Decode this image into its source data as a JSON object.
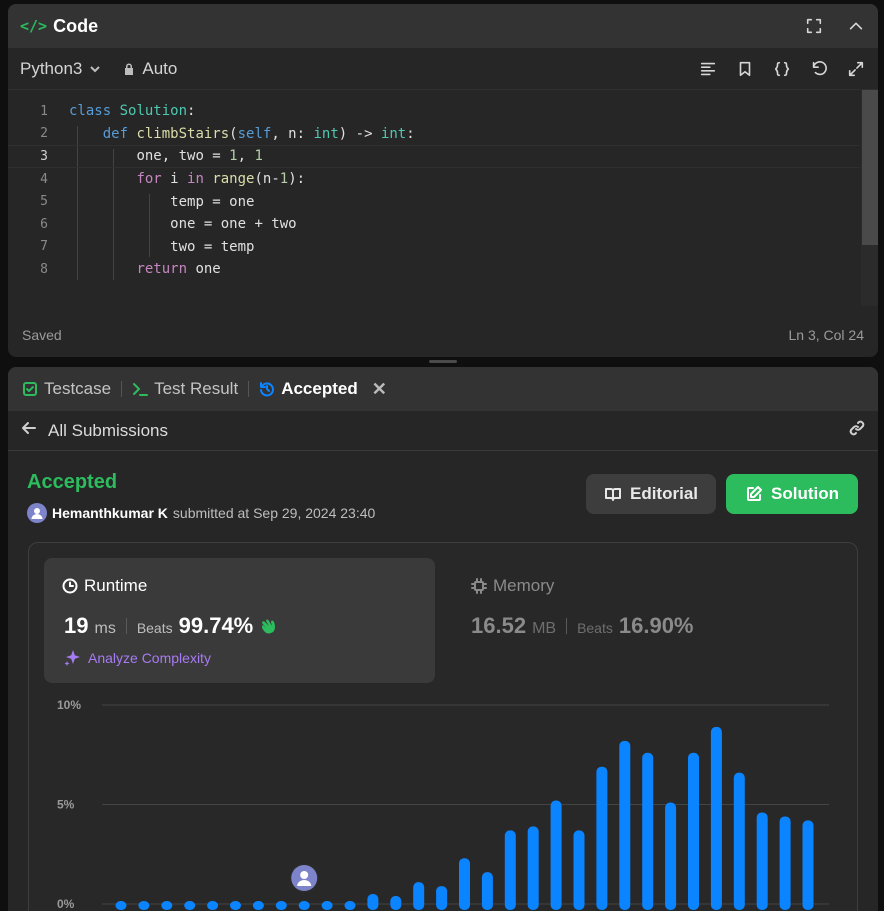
{
  "code_panel": {
    "title": "Code",
    "language": "Python3",
    "mode": "Auto",
    "status": "Saved",
    "cursor_position": "Ln 3, Col 24",
    "current_line": 3,
    "lines": [
      {
        "n": "1"
      },
      {
        "n": "2"
      },
      {
        "n": "3"
      },
      {
        "n": "4"
      },
      {
        "n": "5"
      },
      {
        "n": "6"
      },
      {
        "n": "7"
      },
      {
        "n": "8"
      }
    ],
    "code": {
      "l1a": "class",
      "l1b": "Solution",
      "l1c": ":",
      "l2a": "def",
      "l2b": "climbStairs",
      "l2c": "(",
      "l2d": "self",
      "l2e": ", n: ",
      "l2f": "int",
      "l2g": ") -> ",
      "l2h": "int",
      "l2i": ":",
      "l3a": "one, two = ",
      "l3b": "1",
      "l3c": ", ",
      "l3d": "1",
      "l4a": "for",
      "l4b": " i ",
      "l4c": "in",
      "l4d": " ",
      "l4e": "range",
      "l4f": "(n-",
      "l4g": "1",
      "l4h": "):",
      "l5": "temp = one",
      "l6": "one = one + two",
      "l7": "two = temp",
      "l8a": "return",
      "l8b": " one"
    }
  },
  "result_panel": {
    "tabs": [
      {
        "label": "Testcase"
      },
      {
        "label": "Test Result"
      },
      {
        "label": "Accepted"
      }
    ],
    "back_label": "All Submissions",
    "verdict": "Accepted",
    "submitter": "Hemanthkumar K",
    "submitted_text": "submitted at Sep 29, 2024 23:40",
    "editorial_label": "Editorial",
    "solution_label": "Solution",
    "runtime": {
      "title": "Runtime",
      "value": "19",
      "unit": "ms",
      "beats_label": "Beats",
      "beats": "99.74%"
    },
    "memory": {
      "title": "Memory",
      "value": "16.52",
      "unit": "MB",
      "beats_label": "Beats",
      "beats": "16.90%"
    },
    "analyze_label": "Analyze Complexity"
  },
  "colors": {
    "accent_green": "#2cbb5d",
    "bar_blue": "#0a84ff",
    "analyze_purple": "#a77bf3"
  },
  "chart_data": {
    "type": "bar",
    "ylabel": "",
    "xlabel": "",
    "y_ticks": [
      "10%",
      "5%",
      "0%"
    ],
    "ylim": [
      0,
      10
    ],
    "grid": true,
    "user_bar_index": 8,
    "values": [
      0.15,
      0.15,
      0.15,
      0.15,
      0.15,
      0.15,
      0.15,
      0.15,
      0.15,
      0.15,
      0.15,
      0.5,
      0.4,
      1.1,
      0.9,
      2.3,
      1.6,
      3.7,
      3.9,
      5.2,
      3.7,
      6.9,
      8.2,
      7.6,
      5.1,
      7.6,
      8.9,
      6.6,
      4.6,
      4.4,
      4.2
    ]
  }
}
